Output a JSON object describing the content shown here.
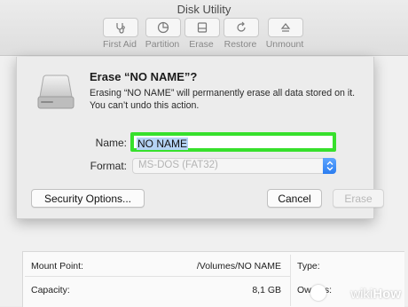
{
  "window": {
    "title": "Disk Utility"
  },
  "toolbar": {
    "items": [
      {
        "label": "First Aid",
        "icon": "stethoscope-icon"
      },
      {
        "label": "Partition",
        "icon": "pie-chart-icon"
      },
      {
        "label": "Erase",
        "icon": "eraser-icon"
      },
      {
        "label": "Restore",
        "icon": "restore-icon"
      },
      {
        "label": "Unmount",
        "icon": "eject-icon"
      }
    ]
  },
  "dialog": {
    "title": "Erase “NO NAME”?",
    "message": "Erasing “NO NAME” will permanently erase all data stored on it. You can’t undo this action.",
    "name_label": "Name:",
    "name_value": "NO NAME",
    "format_label": "Format:",
    "format_value": "MS-DOS (FAT32)",
    "security_button": "Security Options...",
    "cancel_button": "Cancel",
    "erase_button": "Erase"
  },
  "info": {
    "mount_point_label": "Mount Point:",
    "mount_point_value": "/Volumes/NO NAME",
    "capacity_label": "Capacity:",
    "capacity_value": "8,1 GB",
    "type_label": "Type:",
    "owners_label": "Owners:"
  },
  "watermark": {
    "wiki": "wiki",
    "how": "How"
  },
  "colors": {
    "highlight": "#37e02c",
    "accent": "#2b7df0"
  }
}
